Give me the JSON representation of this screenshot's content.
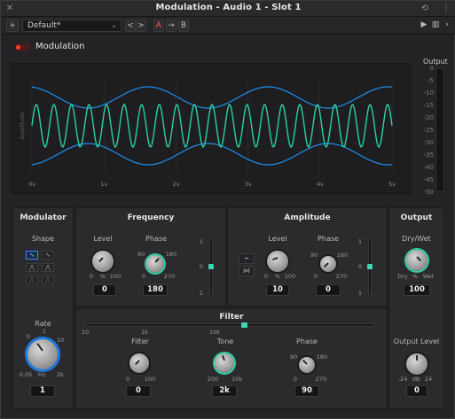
{
  "window": {
    "title": "Modulation - Audio 1 - Slot 1"
  },
  "toolbar": {
    "preset": "Default*",
    "prev": "<",
    "next": ">",
    "a_label": "A",
    "arrow_label": "→",
    "b_label": "B",
    "add_label": "+"
  },
  "modulation": {
    "label": "Modulation",
    "enabled": true
  },
  "scope": {
    "y_axis_label": "Amplitude",
    "x_ticks": [
      "0s",
      "1s",
      "2s",
      "3s",
      "4s",
      "5s"
    ],
    "colors": {
      "carrier": "#2ad1a3",
      "envelope": "#1f8ff0"
    }
  },
  "output_meter": {
    "label": "Output",
    "ticks": [
      "0",
      "-5",
      "-10",
      "-15",
      "-20",
      "-25",
      "-30",
      "-35",
      "-40",
      "-45",
      "-50"
    ]
  },
  "modulator": {
    "title": "Modulator",
    "shape_label": "Shape",
    "shapes": [
      "∿",
      "∿",
      "⋀",
      "⋀",
      "⎍",
      "⎍"
    ],
    "active_shape_index": 0,
    "rate_label": "Rate",
    "rate_scale": {
      "min": "0.05",
      "unit": "Hz",
      "max": "2k",
      "mark_left": "0",
      "mark_top": "1",
      "mark_right": "10"
    },
    "rate_value": "1"
  },
  "frequency": {
    "title": "Frequency",
    "level_label": "Level",
    "level_scale": {
      "min": "0",
      "unit": "%",
      "max": "100"
    },
    "level_value": "0",
    "phase_label": "Phase",
    "phase_scale": {
      "min": "0",
      "max": "270",
      "left": "90",
      "right": "180"
    },
    "phase_value": "180",
    "slider_scale": {
      "top": "1",
      "mid": "0",
      "bottom": "1"
    }
  },
  "amplitude": {
    "title": "Amplitude",
    "level_label": "Level",
    "level_scale": {
      "min": "0",
      "unit": "%",
      "max": "100"
    },
    "level_value": "10",
    "phase_label": "Phase",
    "phase_scale": {
      "min": "0",
      "max": "270",
      "left": "90",
      "right": "180"
    },
    "phase_value": "0",
    "slider_scale": {
      "top": "1",
      "mid": "0",
      "bottom": "1"
    }
  },
  "output": {
    "title": "Output",
    "drywet_label": "Dry/Wet",
    "drywet_scale": {
      "dry": "Dry",
      "unit": "%",
      "wet": "Wet"
    },
    "drywet_value": "100",
    "level_label": "Output Level",
    "level_scale": {
      "min": "-24",
      "unit": "dB",
      "max": "24"
    },
    "level_value": "0"
  },
  "filter": {
    "title": "Filter",
    "range_ticks": [
      "10",
      "1k",
      "10k"
    ],
    "filter_label": "Filter",
    "filter_scale": {
      "min": "0",
      "max": "100"
    },
    "filter_value": "0",
    "tone_label": "Tone",
    "tone_scale": {
      "min": "200",
      "max": "10k"
    },
    "tone_value": "2k",
    "phase_label": "Phase",
    "phase_scale": {
      "min": "0",
      "max": "270",
      "left": "90",
      "right": "180"
    },
    "phase_value": "90"
  }
}
